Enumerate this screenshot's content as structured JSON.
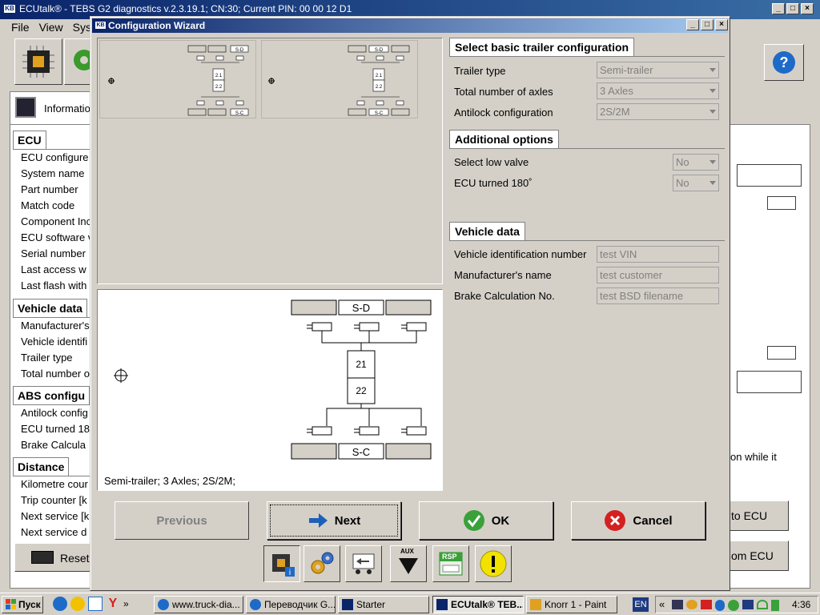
{
  "app": {
    "title": "ECUtalk® - TEBS G2 diagnostics v.2.3.19.1; CN:30; Current PIN: 00 00 12 D1",
    "icon_text": "KB",
    "menu": [
      "File",
      "View",
      "Sys"
    ],
    "info_tab": "Informatio",
    "help_label": "?"
  },
  "bg": {
    "ecu_header": "ECU",
    "ecu_rows": [
      "ECU configure",
      "System name",
      "Part number",
      "Match code",
      "Component Inc",
      "ECU software v",
      "Serial number",
      "Last access w",
      "Last flash with"
    ],
    "vehicle_header": "Vehicle data",
    "vehicle_rows": [
      "Manufacturer's",
      "Vehicle identifi",
      "Trailer type",
      "Total number o"
    ],
    "abs_header": "ABS configu",
    "abs_rows": [
      "Antilock config",
      "ECU turned 18",
      "Brake Calcula"
    ],
    "distance_header": "Distance",
    "distance_rows": [
      "Kilometre cour",
      "Trip counter [k",
      "Next service [k",
      "Next service d"
    ],
    "reset_label": "Reset",
    "right_text": "on while it",
    "to_ecu": "to ECU",
    "from_ecu": "om ECU"
  },
  "dialog": {
    "title": "Configuration Wizard",
    "icon_text": "KB",
    "basic": {
      "header": "Select basic trailer configuration",
      "rows": [
        {
          "label": "Trailer type",
          "value": "Semi-trailer"
        },
        {
          "label": "Total number of axles",
          "value": "3 Axles"
        },
        {
          "label": "Antilock configuration",
          "value": "2S/2M"
        }
      ]
    },
    "options": {
      "header": "Additional options",
      "rows": [
        {
          "label": "Select low valve",
          "value": "No"
        },
        {
          "label": "ECU turned 180˚",
          "value": "No"
        }
      ]
    },
    "vehicle": {
      "header": "Vehicle data",
      "rows": [
        {
          "label": "Vehicle identification number",
          "value": "test VIN"
        },
        {
          "label": "Manufacturer's name",
          "value": "test customer"
        },
        {
          "label": "Brake Calculation No.",
          "value": "test BSD filename"
        }
      ]
    },
    "thumb_a": {
      "top_label": "S-D",
      "bottom_label": "S-C",
      "ecu_top": "2.1",
      "ecu_bottom": "2.2"
    },
    "thumb_b": {
      "top_label": "S-D",
      "bottom_label": "S-C",
      "ecu_top": "2.1",
      "ecu_bottom": "2.2"
    },
    "diagram": {
      "top_label": "S-D",
      "bottom_label": "S-C",
      "ecu_top": "21",
      "ecu_bottom": "22"
    },
    "caption": "Semi-trailer; 3 Axles; 2S/2M;",
    "buttons": {
      "previous": "Previous",
      "next": "Next",
      "ok": "OK",
      "cancel": "Cancel"
    },
    "aux_label": "AUX",
    "rsp_label": "RSP"
  },
  "taskbar": {
    "start": "Пуск",
    "tasks": [
      "www.truck-dia...",
      "Переводчик G...",
      "Starter",
      "ECUtalk® TEB...",
      "Knorr 1 - Paint"
    ],
    "lang": "EN",
    "clock": "4:36"
  },
  "colors": {
    "title_blue": "#0a246a",
    "ok_green": "#3aa13a",
    "cancel_red": "#d42020",
    "next_blue": "#1e5fb8",
    "warn_yellow": "#f2e200"
  }
}
